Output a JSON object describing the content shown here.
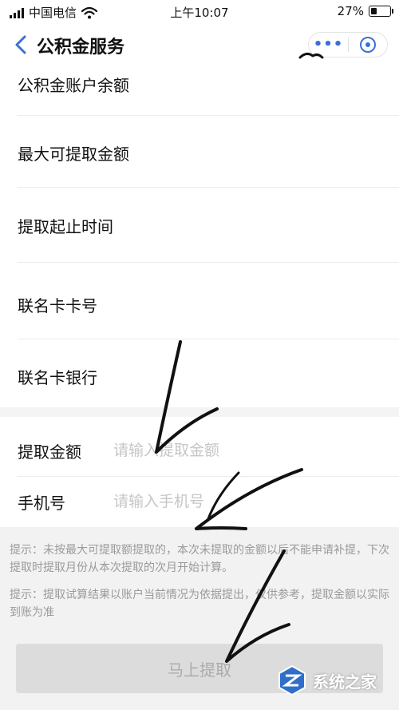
{
  "status_bar": {
    "carrier": "中国电信",
    "time": "上午10:07",
    "battery": "27%",
    "battery_level": 0.27
  },
  "nav": {
    "title": "公积金服务",
    "more_icon": "more-dots-icon",
    "close_icon": "mini-program-close-icon"
  },
  "rows": [
    {
      "label": "公积金账户余额"
    },
    {
      "label": "最大可提取金额"
    },
    {
      "label": "提取起止时间"
    },
    {
      "label": "联名卡卡号"
    },
    {
      "label": "联名卡银行"
    }
  ],
  "form": {
    "amount": {
      "label": "提取金额",
      "placeholder": "请输入提取金额",
      "value": ""
    },
    "phone": {
      "label": "手机号",
      "placeholder": "请输入手机号",
      "value": ""
    }
  },
  "tips": [
    "提示：未按最大可提取额提取的，本次未提取的金额以后不能申请补提，下次提取时提取月份从本次提取的次月开始计算。",
    "提示：提取试算结果以账户当前情况为依据提出，仅供参考，提取金额以实际到账为准"
  ],
  "submit": {
    "label": "马上提取",
    "enabled": false
  },
  "watermark": {
    "text": "系统之家"
  },
  "colors": {
    "accent": "#3b6fd8",
    "background": "#ffffff",
    "gray_area": "#f2f2f2",
    "button_disabled": "#dcdcdc"
  }
}
